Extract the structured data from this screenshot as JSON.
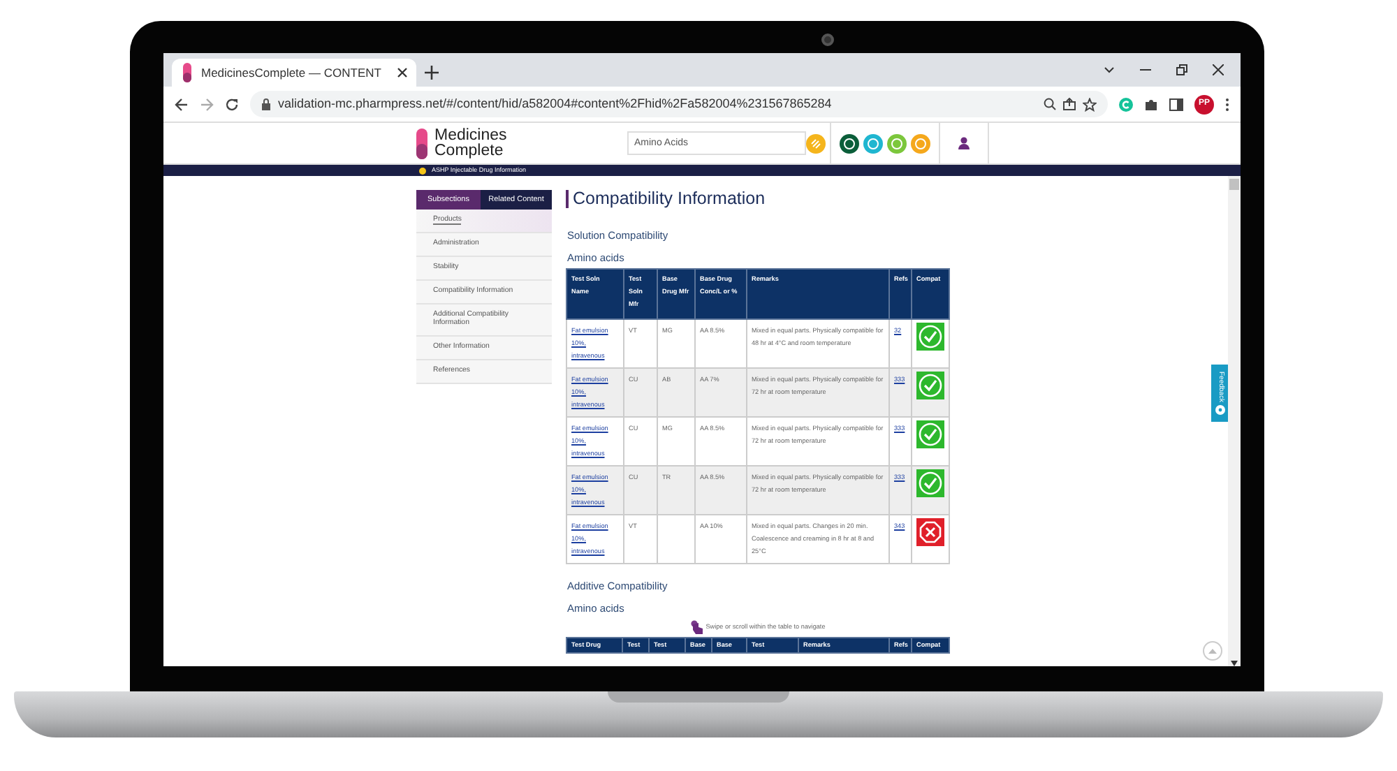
{
  "browser": {
    "tabs": [
      {
        "title": "MedicinesComplete — CONTENT",
        "selected": true
      }
    ],
    "url": "validation-mc.pharmpress.net/#/content/hid/a582004#content%2Fhid%2Fa582004%231567865284",
    "profile": "PP"
  },
  "site": {
    "logo": [
      "Medicines",
      "Complete"
    ],
    "search": {
      "value": "Amino Acids"
    },
    "banner": "ASHP Injectable Drug Information",
    "apps": [
      {
        "color": "#0b5e3a"
      },
      {
        "color": "#1fb6d0"
      },
      {
        "color": "#7cc73c"
      },
      {
        "color": "#f5a81c"
      }
    ]
  },
  "sidebar": {
    "tabs": [
      {
        "label": "Subsections",
        "selected": true
      },
      {
        "label": "Related Content",
        "selected": false
      }
    ],
    "items": [
      {
        "label": "Products",
        "selected": true
      },
      {
        "label": "Administration",
        "selected": false
      },
      {
        "label": "Stability",
        "selected": false
      },
      {
        "label": "Compatibility Information",
        "selected": false
      },
      {
        "label": "Additional Compatibility Information",
        "selected": false
      },
      {
        "label": "Other Information",
        "selected": false
      },
      {
        "label": "References",
        "selected": false
      }
    ]
  },
  "heading": "Compatibility Information",
  "solution": {
    "title": "Solution Compatibility",
    "subtitle": "Amino acids",
    "columns": [
      "Test Soln Name",
      "Test Soln Mfr",
      "Base Drug Mfr",
      "Base Drug Conc/L or %",
      "Remarks",
      "Refs",
      "Compat"
    ],
    "rows": [
      {
        "name": "Fat emulsion 10%, intravenous",
        "soln_mfr": "VT",
        "drug_mfr": "MG",
        "conc": "AA 8.5%",
        "remarks": "Mixed in equal parts. Physically compatible for 48 hr at 4°C and room temperature",
        "ref": "32",
        "compatible": true
      },
      {
        "name": "Fat emulsion 10%, intravenous",
        "soln_mfr": "CU",
        "drug_mfr": "AB",
        "conc": "AA 7%",
        "remarks": "Mixed in equal parts. Physically compatible for 72 hr at room temperature",
        "ref": "333",
        "compatible": true
      },
      {
        "name": "Fat emulsion 10%, intravenous",
        "soln_mfr": "CU",
        "drug_mfr": "MG",
        "conc": "AA 8.5%",
        "remarks": "Mixed in equal parts. Physically compatible for 72 hr at room temperature",
        "ref": "333",
        "compatible": true
      },
      {
        "name": "Fat emulsion 10%, intravenous",
        "soln_mfr": "CU",
        "drug_mfr": "TR",
        "conc": "AA 8.5%",
        "remarks": "Mixed in equal parts. Physically compatible for 72 hr at room temperature",
        "ref": "333",
        "compatible": true
      },
      {
        "name": "Fat emulsion 10%, intravenous",
        "soln_mfr": "VT",
        "conc": "AA 10%",
        "remarks": "Mixed in equal parts. Changes in 20 min. Coalescence and creaming in 8 hr at 8 and 25°C",
        "ref": "343",
        "compatible": false
      }
    ]
  },
  "additive": {
    "title": "Additive Compatibility",
    "subtitle": "Amino acids",
    "hint": "Swipe or scroll within the table to navigate",
    "columns": [
      "Test Drug",
      "Test",
      "Test",
      "Base",
      "Base",
      "Test",
      "Remarks",
      "Refs",
      "Compat"
    ]
  },
  "feedback": "Feedback"
}
